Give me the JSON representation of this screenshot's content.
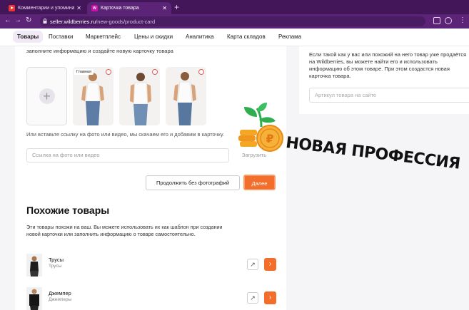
{
  "browser": {
    "tabs": [
      {
        "title": "Комментарии и упоминания",
        "favicon": "youtube-icon"
      },
      {
        "title": "Карточка товара",
        "favicon": "wb-icon"
      }
    ],
    "new_tab": "+",
    "url_host": "seller.wildberries.ru",
    "url_path": "/new-goods/product-card"
  },
  "nav": {
    "items": [
      "Товары",
      "Поставки",
      "Маркетплейс",
      "Цены и скидки",
      "Аналитика",
      "Карта складов",
      "Реклама"
    ],
    "active": "Товары"
  },
  "upload": {
    "intro": "заполните информацию и создайте новую карточку товара",
    "main_badge": "Главная",
    "hint": "Или вставьте ссылку на фото или видео, мы скачаем его и добавим в карточку.",
    "link_placeholder": "Ссылка на фото или видео",
    "load_label": "Загрузить",
    "skip_label": "Продолжить без фотографий",
    "next_label": "Далее"
  },
  "similar": {
    "title": "Похожие товары",
    "description": "Эти товары похожи на ваш. Вы можете использовать их как шаблон при создании новой карточки или заполнить информацию о товаре самостоятельно.",
    "items": [
      {
        "name": "Трусы",
        "category": "Трусы"
      },
      {
        "name": "Джемпер",
        "category": "Джемперы"
      }
    ]
  },
  "right_panel": {
    "text": "Если такой как у вас или похожий на него товар уже продаётся на Wildberries, вы можете найти его и использовать информацию об этом товаре. При этом создастся новая карточка товара.",
    "search_placeholder": "Артикул товара на сайте"
  },
  "overlay": {
    "slogan": "НОВАЯ ПРОФЕССИЯ",
    "coin_symbol": "₽",
    "colors": {
      "accent_orange": "#f36e2b",
      "brand_purple": "#5b2476",
      "leaf_green": "#2fae4f",
      "coin_gold": "#f5a623"
    }
  }
}
